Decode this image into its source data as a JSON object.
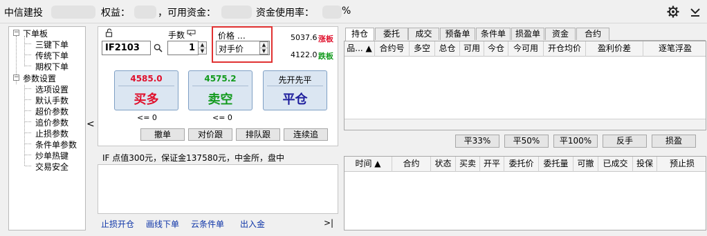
{
  "titlebar": {
    "broker": "中信建投",
    "equity_label": "权益：",
    "available_label": "，可用资金：",
    "usage_label": "资金使用率：",
    "usage_suffix": "%",
    "settings_icon": "gear-icon",
    "collapse_icon": "chevron-down-icon"
  },
  "tree": {
    "groups": [
      {
        "toggle": "−",
        "label": "下单板",
        "children": [
          "三键下单",
          "传统下单",
          "期权下单"
        ]
      },
      {
        "toggle": "−",
        "label": "参数设置",
        "children": [
          "选项设置",
          "默认手数",
          "超价参数",
          "追价参数",
          "止损参数",
          "条件单参数",
          "炒单热键",
          "交易安全"
        ]
      }
    ],
    "collapse_glyph": "<"
  },
  "order": {
    "lock_icon": "unlock-icon",
    "contract": "IF2103",
    "search_icon": "search-icon",
    "qty_label": "手数",
    "qty_icon": "return-icon",
    "qty_value": "1",
    "price_label": "价格 …",
    "price_value": "对手价",
    "limit_up_price": "5037.6",
    "limit_up_label": "涨板",
    "limit_down_price": "4122.0",
    "limit_down_label": "跌板",
    "buy": {
      "price": "4585.0",
      "label": "买多",
      "note": "<= 0"
    },
    "sell": {
      "price": "4575.2",
      "label": "卖空",
      "note": "<= 0"
    },
    "close": {
      "top": "先开先平",
      "label": "平仓"
    },
    "cancel_label": "撤单",
    "follow_label": "对价跟",
    "queue_label": "排队跟",
    "chase_label": "连续追",
    "info_text": "IF 点值300元，保证金137580元，中金所，盘中"
  },
  "bottom_links": [
    "止损开仓",
    "画线下单",
    "云条件单",
    "出入金"
  ],
  "bottom_expand": ">|",
  "tabs": [
    "持仓",
    "委托",
    "成交",
    "预备单",
    "条件单",
    "损盈单",
    "资金",
    "合约"
  ],
  "positions": {
    "columns": [
      "品... ▲",
      "合约号",
      "多空",
      "总仓",
      "可用",
      "今仓",
      "今可用",
      "开仓均价",
      "盈利价差",
      "逐笔浮盈"
    ]
  },
  "position_actions": [
    "平33%",
    "平50%",
    "平100%",
    "反手",
    "损盈"
  ],
  "orders": {
    "columns": [
      "时间 ▲",
      "合约",
      "状态",
      "买卖",
      "开平",
      "委托价",
      "委托量",
      "可撤",
      "已成交",
      "投保",
      "预止损"
    ]
  },
  "colors": {
    "buy": "#e0102c",
    "sell": "#129a1d",
    "close": "#1d1d9c",
    "link": "#0e35a8",
    "highlight": "#e03030"
  }
}
